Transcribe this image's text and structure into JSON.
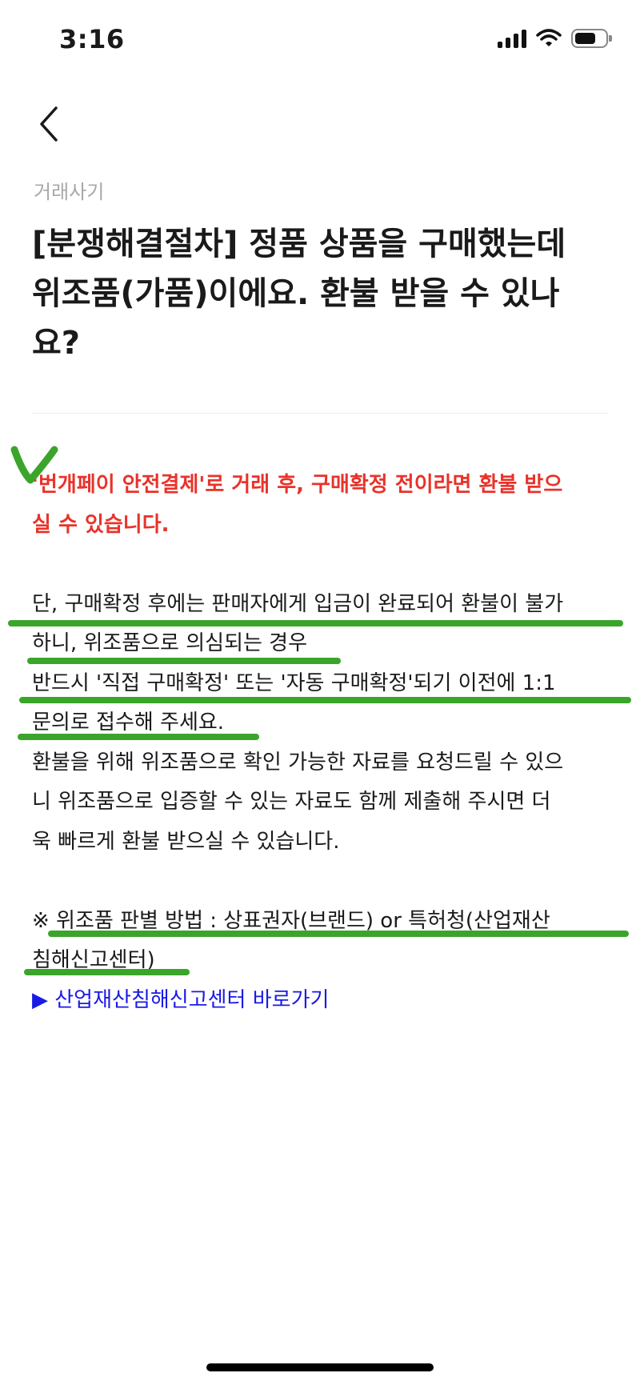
{
  "status_bar": {
    "time": "3:16",
    "icons": [
      "signal-icon",
      "wifi-icon",
      "battery-icon"
    ]
  },
  "nav": {
    "back_icon": "chevron-left-icon"
  },
  "article": {
    "category": "거래사기",
    "title_lines": [
      "[분쟁해결절차] 정품 상품을 구매했는데",
      "위조품(가품)이에요. 환불 받을 수 있나",
      "요?"
    ],
    "notice_lines": [
      "'번개페이 안전결제'로 거래 후, 구매확정 전이라면 환불 받으",
      "실 수 있습니다."
    ],
    "body_lines": [
      "단, 구매확정 후에는 판매자에게 입금이 완료되어 환불이 불가",
      "하니, 위조품으로 의심되는 경우",
      "반드시 '직접 구매확정' 또는 '자동 구매확정'되기 이전에  1:1",
      "문의로 접수해 주세요.",
      "환불을 위해 위조품으로 확인 가능한 자료를 요청드릴 수 있으",
      "니 위조품으로 입증할 수 있는 자료도 함께 제출해 주시면 더",
      "욱 빠르게 환불 받으실 수 있습니다."
    ],
    "note_lines": [
      "※ 위조품 판별 방법 : 상표권자(브랜드) or 특허청(산업재산",
      "침해신고센터)"
    ],
    "link_text": "▶ 산업재산침해신고센터 바로가기"
  },
  "colors": {
    "notice": "#e8332a",
    "link": "#1a1ae6",
    "annotation": "#3aa52a",
    "category": "#a8a8a8"
  }
}
